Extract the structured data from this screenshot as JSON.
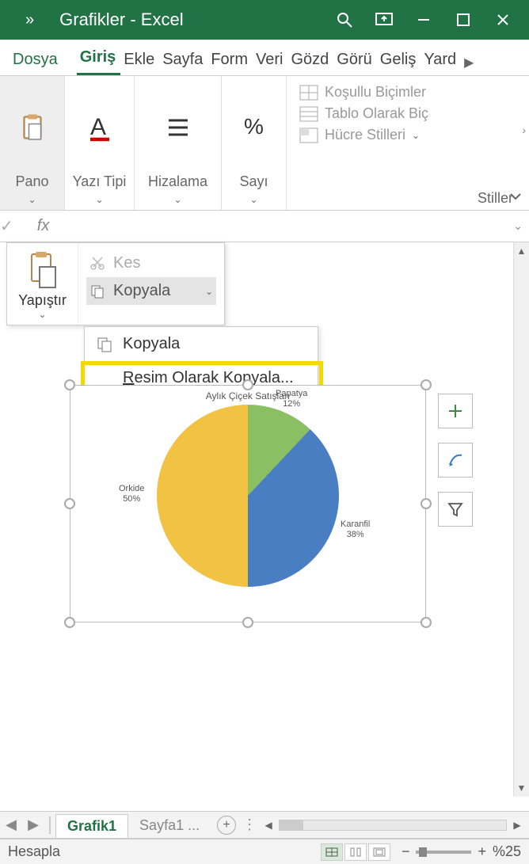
{
  "titlebar": {
    "more": "»",
    "title": "Grafikler  -  Excel"
  },
  "tabs": {
    "file": "Dosya",
    "list": [
      "Giriş",
      "Ekle",
      "Sayfa",
      "Form",
      "Veri",
      "Gözd",
      "Görü",
      "Geliş",
      "Yard"
    ],
    "active_index": 0
  },
  "ribbon": {
    "pano": {
      "label": "Pano"
    },
    "font": {
      "label": "Yazı Tipi"
    },
    "align": {
      "label": "Hizalama"
    },
    "number": {
      "label": "Sayı",
      "symbol": "%"
    },
    "styles": {
      "label": "Stiller",
      "cond": "Koşullu Biçimler",
      "table": "Tablo Olarak Biç",
      "cell": "Hücre Stilleri"
    }
  },
  "paste_panel": {
    "paste": "Yapıştır",
    "cut": "Kes",
    "copy": "Kopyala",
    "sub_copy": "Kopyala",
    "sub_copy_as_picture": "Resim Olarak Kopyala...",
    "underline_char": "R"
  },
  "fx": {
    "check": "✓",
    "fx": "fx"
  },
  "chart_data": {
    "type": "pie",
    "title": "Aylık Çiçek Satışları",
    "series": [
      {
        "name": "Papatya",
        "value": 12
      },
      {
        "name": "Karanfil",
        "value": 38
      },
      {
        "name": "Orkide",
        "value": 50
      }
    ],
    "value_suffix": "%"
  },
  "sheet_tabs": {
    "active": "Grafik1",
    "next": "Sayfa1 ..."
  },
  "statusbar": {
    "calc": "Hesapla",
    "zoom_minus": "−",
    "zoom_plus": "+",
    "zoom": "%25"
  }
}
